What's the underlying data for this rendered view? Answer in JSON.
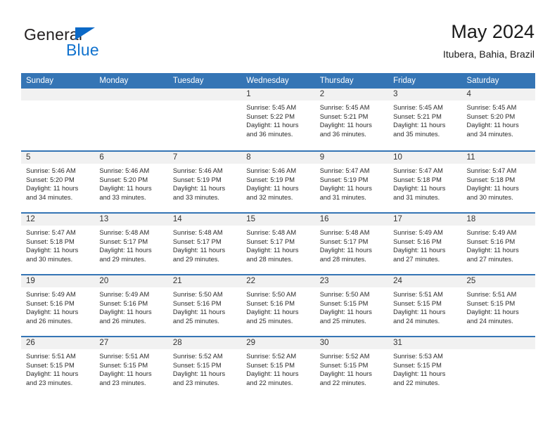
{
  "brand": {
    "word_one": "General",
    "word_two": "Blue",
    "triangle_icon": "triangle-icon",
    "color_dark": "#231f20",
    "color_blue": "#1072ce"
  },
  "header": {
    "title": "May 2024",
    "subtitle": "Itubera, Bahia, Brazil"
  },
  "theme": {
    "header_blue": "#3575b5",
    "day_band_gray": "#f1f1f1",
    "text_color": "#2b2b2b"
  },
  "weekday_headers": [
    "Sunday",
    "Monday",
    "Tuesday",
    "Wednesday",
    "Thursday",
    "Friday",
    "Saturday"
  ],
  "weeks": [
    [
      {
        "day": "",
        "empty": true,
        "sunrise": "",
        "sunset": "",
        "daylight": ""
      },
      {
        "day": "",
        "empty": true,
        "sunrise": "",
        "sunset": "",
        "daylight": ""
      },
      {
        "day": "",
        "empty": true,
        "sunrise": "",
        "sunset": "",
        "daylight": ""
      },
      {
        "day": "1",
        "sunrise": "Sunrise: 5:45 AM",
        "sunset": "Sunset: 5:22 PM",
        "daylight": "Daylight: 11 hours and 36 minutes."
      },
      {
        "day": "2",
        "sunrise": "Sunrise: 5:45 AM",
        "sunset": "Sunset: 5:21 PM",
        "daylight": "Daylight: 11 hours and 36 minutes."
      },
      {
        "day": "3",
        "sunrise": "Sunrise: 5:45 AM",
        "sunset": "Sunset: 5:21 PM",
        "daylight": "Daylight: 11 hours and 35 minutes."
      },
      {
        "day": "4",
        "sunrise": "Sunrise: 5:45 AM",
        "sunset": "Sunset: 5:20 PM",
        "daylight": "Daylight: 11 hours and 34 minutes."
      }
    ],
    [
      {
        "day": "5",
        "sunrise": "Sunrise: 5:46 AM",
        "sunset": "Sunset: 5:20 PM",
        "daylight": "Daylight: 11 hours and 34 minutes."
      },
      {
        "day": "6",
        "sunrise": "Sunrise: 5:46 AM",
        "sunset": "Sunset: 5:20 PM",
        "daylight": "Daylight: 11 hours and 33 minutes."
      },
      {
        "day": "7",
        "sunrise": "Sunrise: 5:46 AM",
        "sunset": "Sunset: 5:19 PM",
        "daylight": "Daylight: 11 hours and 33 minutes."
      },
      {
        "day": "8",
        "sunrise": "Sunrise: 5:46 AM",
        "sunset": "Sunset: 5:19 PM",
        "daylight": "Daylight: 11 hours and 32 minutes."
      },
      {
        "day": "9",
        "sunrise": "Sunrise: 5:47 AM",
        "sunset": "Sunset: 5:19 PM",
        "daylight": "Daylight: 11 hours and 31 minutes."
      },
      {
        "day": "10",
        "sunrise": "Sunrise: 5:47 AM",
        "sunset": "Sunset: 5:18 PM",
        "daylight": "Daylight: 11 hours and 31 minutes."
      },
      {
        "day": "11",
        "sunrise": "Sunrise: 5:47 AM",
        "sunset": "Sunset: 5:18 PM",
        "daylight": "Daylight: 11 hours and 30 minutes."
      }
    ],
    [
      {
        "day": "12",
        "sunrise": "Sunrise: 5:47 AM",
        "sunset": "Sunset: 5:18 PM",
        "daylight": "Daylight: 11 hours and 30 minutes."
      },
      {
        "day": "13",
        "sunrise": "Sunrise: 5:48 AM",
        "sunset": "Sunset: 5:17 PM",
        "daylight": "Daylight: 11 hours and 29 minutes."
      },
      {
        "day": "14",
        "sunrise": "Sunrise: 5:48 AM",
        "sunset": "Sunset: 5:17 PM",
        "daylight": "Daylight: 11 hours and 29 minutes."
      },
      {
        "day": "15",
        "sunrise": "Sunrise: 5:48 AM",
        "sunset": "Sunset: 5:17 PM",
        "daylight": "Daylight: 11 hours and 28 minutes."
      },
      {
        "day": "16",
        "sunrise": "Sunrise: 5:48 AM",
        "sunset": "Sunset: 5:17 PM",
        "daylight": "Daylight: 11 hours and 28 minutes."
      },
      {
        "day": "17",
        "sunrise": "Sunrise: 5:49 AM",
        "sunset": "Sunset: 5:16 PM",
        "daylight": "Daylight: 11 hours and 27 minutes."
      },
      {
        "day": "18",
        "sunrise": "Sunrise: 5:49 AM",
        "sunset": "Sunset: 5:16 PM",
        "daylight": "Daylight: 11 hours and 27 minutes."
      }
    ],
    [
      {
        "day": "19",
        "sunrise": "Sunrise: 5:49 AM",
        "sunset": "Sunset: 5:16 PM",
        "daylight": "Daylight: 11 hours and 26 minutes."
      },
      {
        "day": "20",
        "sunrise": "Sunrise: 5:49 AM",
        "sunset": "Sunset: 5:16 PM",
        "daylight": "Daylight: 11 hours and 26 minutes."
      },
      {
        "day": "21",
        "sunrise": "Sunrise: 5:50 AM",
        "sunset": "Sunset: 5:16 PM",
        "daylight": "Daylight: 11 hours and 25 minutes."
      },
      {
        "day": "22",
        "sunrise": "Sunrise: 5:50 AM",
        "sunset": "Sunset: 5:16 PM",
        "daylight": "Daylight: 11 hours and 25 minutes."
      },
      {
        "day": "23",
        "sunrise": "Sunrise: 5:50 AM",
        "sunset": "Sunset: 5:15 PM",
        "daylight": "Daylight: 11 hours and 25 minutes."
      },
      {
        "day": "24",
        "sunrise": "Sunrise: 5:51 AM",
        "sunset": "Sunset: 5:15 PM",
        "daylight": "Daylight: 11 hours and 24 minutes."
      },
      {
        "day": "25",
        "sunrise": "Sunrise: 5:51 AM",
        "sunset": "Sunset: 5:15 PM",
        "daylight": "Daylight: 11 hours and 24 minutes."
      }
    ],
    [
      {
        "day": "26",
        "sunrise": "Sunrise: 5:51 AM",
        "sunset": "Sunset: 5:15 PM",
        "daylight": "Daylight: 11 hours and 23 minutes."
      },
      {
        "day": "27",
        "sunrise": "Sunrise: 5:51 AM",
        "sunset": "Sunset: 5:15 PM",
        "daylight": "Daylight: 11 hours and 23 minutes."
      },
      {
        "day": "28",
        "sunrise": "Sunrise: 5:52 AM",
        "sunset": "Sunset: 5:15 PM",
        "daylight": "Daylight: 11 hours and 23 minutes."
      },
      {
        "day": "29",
        "sunrise": "Sunrise: 5:52 AM",
        "sunset": "Sunset: 5:15 PM",
        "daylight": "Daylight: 11 hours and 22 minutes."
      },
      {
        "day": "30",
        "sunrise": "Sunrise: 5:52 AM",
        "sunset": "Sunset: 5:15 PM",
        "daylight": "Daylight: 11 hours and 22 minutes."
      },
      {
        "day": "31",
        "sunrise": "Sunrise: 5:53 AM",
        "sunset": "Sunset: 5:15 PM",
        "daylight": "Daylight: 11 hours and 22 minutes."
      },
      {
        "day": "",
        "empty": true,
        "sunrise": "",
        "sunset": "",
        "daylight": ""
      }
    ]
  ]
}
